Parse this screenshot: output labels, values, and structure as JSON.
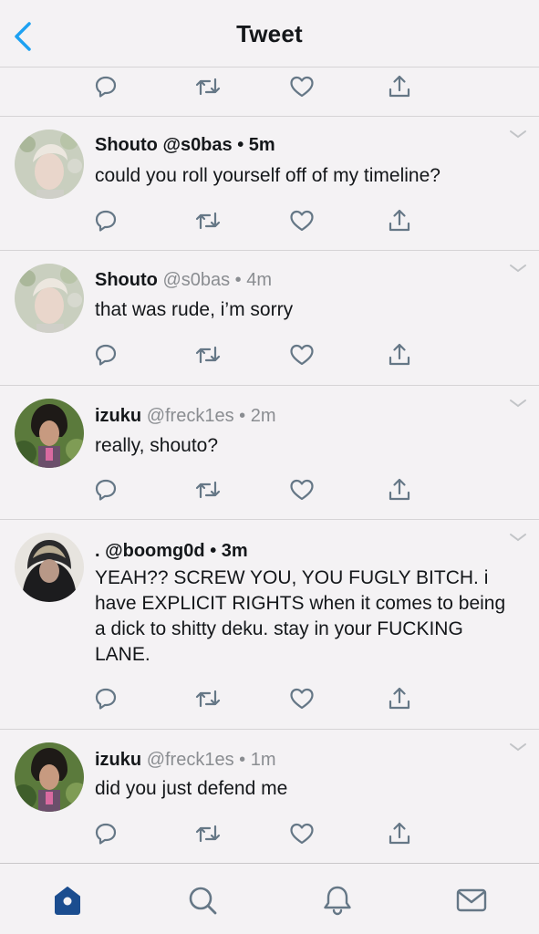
{
  "header": {
    "title": "Tweet"
  },
  "tweets": [
    {
      "name": "Shouto",
      "handle": "@s0bas",
      "time": "5m",
      "text": "could you roll yourself off of my timeline?"
    },
    {
      "name": "Shouto",
      "handle": "@s0bas",
      "time": "4m",
      "text": "that was rude, i’m sorry"
    },
    {
      "name": "izuku",
      "handle": "@freck1es",
      "time": "2m",
      "text": "really, shouto?"
    },
    {
      "name": ".",
      "handle": "@boomg0d",
      "time": "3m",
      "text": "YEAH?? SCREW YOU, YOU FUGLY BITCH. i have EXPLICIT RIGHTS when it comes to being a dick to shitty deku. stay in your FUCKING LANE."
    },
    {
      "name": "izuku",
      "handle": "@freck1es",
      "time": "1m",
      "text": "did you just defend me"
    }
  ],
  "separator": "•",
  "icons": {
    "back": "chevron-left-icon",
    "reply": "reply-icon",
    "retweet": "retweet-icon",
    "like": "heart-icon",
    "share": "share-icon",
    "home": "home-icon",
    "search": "search-icon",
    "notifications": "bell-icon",
    "messages": "mail-icon"
  },
  "colors": {
    "accent": "#1da1f2",
    "active_tab": "#1b4d8f",
    "muted": "#8a8d91",
    "icon": "#657786"
  }
}
